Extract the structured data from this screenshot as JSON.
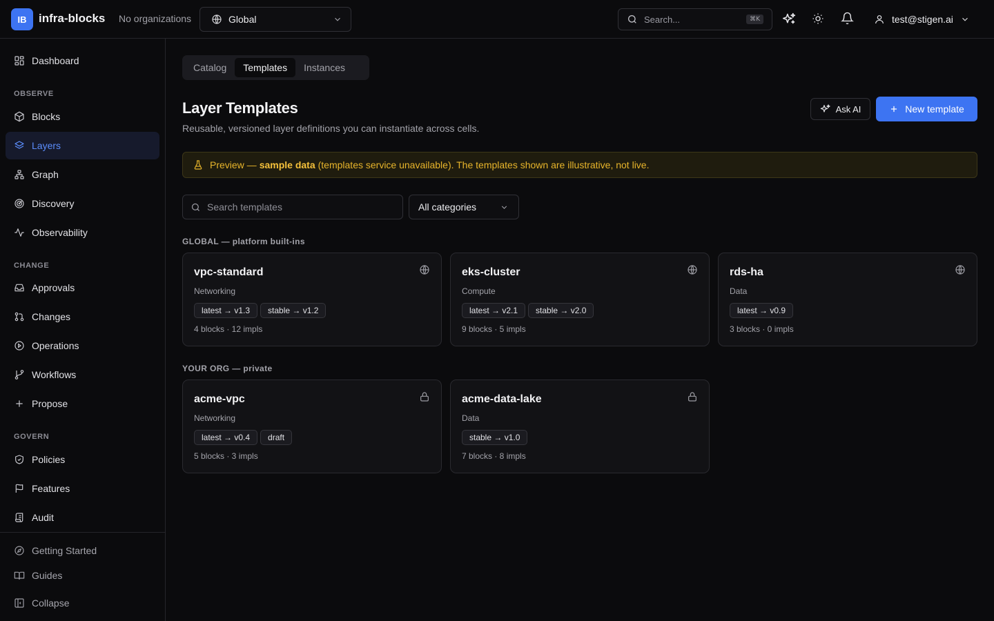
{
  "app": {
    "logo_text": "IB",
    "name": "infra-blocks",
    "org_status": "No organizations"
  },
  "scope": {
    "value": "Global"
  },
  "search": {
    "placeholder": "Search...",
    "shortcut": "⌘K"
  },
  "user": {
    "email": "test@stigen.ai"
  },
  "sidebar": {
    "dashboard": "Dashboard",
    "sections": {
      "observe": "OBSERVE",
      "change": "CHANGE",
      "govern": "GOVERN"
    },
    "observe": [
      "Blocks",
      "Layers",
      "Graph",
      "Discovery",
      "Observability"
    ],
    "change": [
      "Approvals",
      "Changes",
      "Operations",
      "Workflows",
      "Propose"
    ],
    "govern": [
      "Policies",
      "Features",
      "Audit"
    ],
    "footer": [
      "Getting Started",
      "Guides",
      "Collapse"
    ]
  },
  "tabs": [
    "Catalog",
    "Templates",
    "Instances"
  ],
  "page": {
    "title": "Layer Templates",
    "subtitle": "Reusable, versioned layer definitions you can instantiate across cells.",
    "ask_ai": "Ask AI",
    "new_template": "New template"
  },
  "banner": {
    "prefix": "Preview —",
    "strong": "sample data",
    "suffix": "(templates service unavailable). The templates shown are illustrative, not live."
  },
  "filters": {
    "search_placeholder": "Search templates",
    "category": "All categories"
  },
  "groups": [
    {
      "label": "GLOBAL — platform built-ins",
      "cards": [
        {
          "name": "vpc-standard",
          "category": "Networking",
          "pills": [
            "latest → v1.3",
            "stable → v1.2"
          ],
          "meta": "4 blocks · 12 impls"
        },
        {
          "name": "eks-cluster",
          "category": "Compute",
          "pills": [
            "latest → v2.1",
            "stable → v2.0"
          ],
          "meta": "9 blocks · 5 impls"
        },
        {
          "name": "rds-ha",
          "category": "Data",
          "pills": [
            "latest → v0.9"
          ],
          "meta": "3 blocks · 0 impls"
        }
      ]
    },
    {
      "label": "YOUR ORG — private",
      "cards": [
        {
          "name": "acme-vpc",
          "category": "Networking",
          "pills": [
            "latest → v0.4",
            "draft"
          ],
          "meta": "5 blocks · 3 impls"
        },
        {
          "name": "acme-data-lake",
          "category": "Data",
          "pills": [
            "stable → v1.0"
          ],
          "meta": "7 blocks · 8 impls"
        }
      ]
    }
  ],
  "colors": {
    "accent": "#3d74f2",
    "background": "#0b0b0d",
    "warning": "#e8b52b"
  }
}
